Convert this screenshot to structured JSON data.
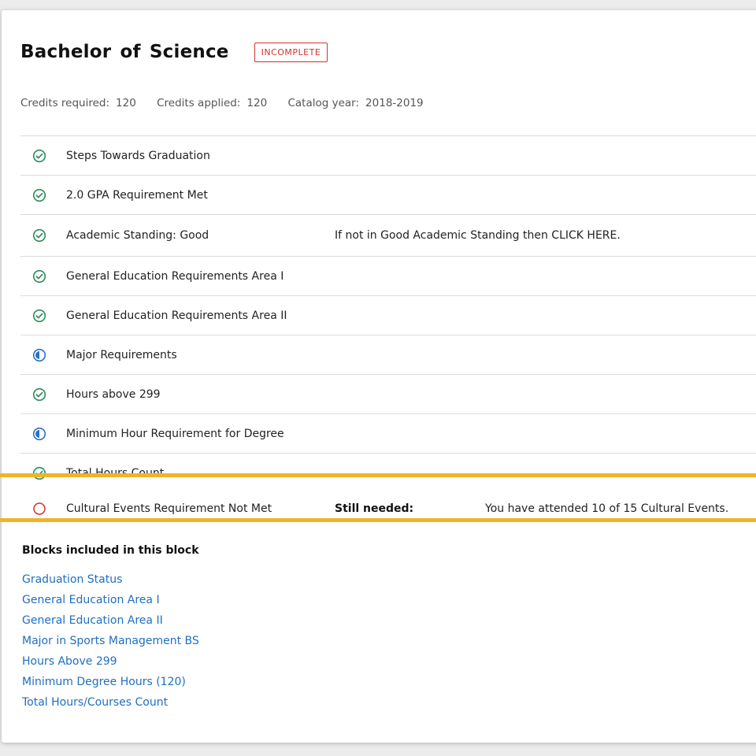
{
  "header": {
    "title": "Bachelor of Science",
    "status_badge": "INCOMPLETE"
  },
  "meta": {
    "credits_required_label": "Credits required:",
    "credits_required": "120",
    "credits_applied_label": "Credits applied:",
    "credits_applied": "120",
    "catalog_year_label": "Catalog year:",
    "catalog_year": "2018-2019"
  },
  "requirements": [
    {
      "label": "Steps Towards Graduation",
      "status": "complete"
    },
    {
      "label": "2.0 GPA Requirement Met",
      "status": "complete"
    },
    {
      "label": "Academic Standing: Good",
      "status": "complete",
      "note": "If not in Good Academic Standing then CLICK HERE."
    },
    {
      "label": "General Education Requirements Area I",
      "status": "complete"
    },
    {
      "label": "General Education Requirements Area II",
      "status": "complete"
    },
    {
      "label": "Major Requirements",
      "status": "in-progress"
    },
    {
      "label": "Hours above 299",
      "status": "complete"
    },
    {
      "label": "Minimum Hour Requirement for Degree",
      "status": "in-progress"
    },
    {
      "label": "Total Hours Count",
      "status": "complete"
    },
    {
      "label": "Cultural Events Requirement Not Met",
      "status": "not-started",
      "still_needed_label": "Still needed:",
      "still_needed_detail": "You have attended 10 of 15 Cultural Events."
    }
  ],
  "blocks": {
    "heading": "Blocks included in this block",
    "links": [
      "Graduation Status",
      "General Education Area I",
      "General Education Area II",
      "Major in Sports Management BS",
      "Hours Above 299",
      "Minimum Degree Hours (120)",
      "Total Hours/Courses Count"
    ]
  },
  "colors": {
    "complete": "#2e8b57",
    "in_progress": "#2a6fc4",
    "not_started": "#d0342c",
    "highlight": "#f0b429",
    "link": "#1e6fc0"
  }
}
